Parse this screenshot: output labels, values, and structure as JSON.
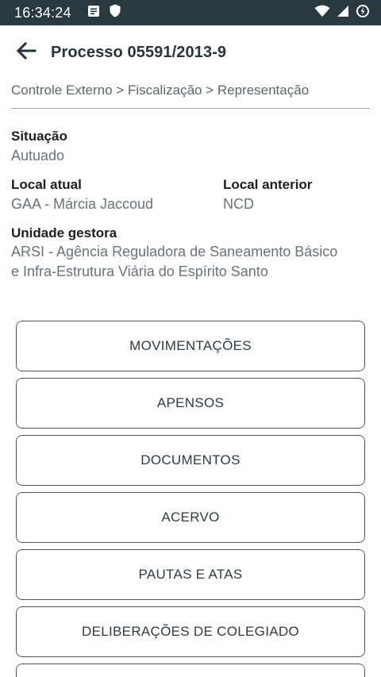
{
  "status_bar": {
    "time": "16:34:24",
    "icons": [
      "notes-icon",
      "shield-icon",
      "wifi-icon",
      "signal-icon",
      "battery-saver-icon"
    ]
  },
  "app_bar": {
    "title": "Processo 05591/2013-9",
    "back_icon": "arrow-left-icon"
  },
  "breadcrumb": "Controle Externo > Fiscalização > Representação",
  "details": {
    "situacao": {
      "label": "Situação",
      "value": "Autuado"
    },
    "local_atual": {
      "label": "Local atual",
      "value": "GAA - Márcia Jaccoud"
    },
    "local_anterior": {
      "label": "Local anterior",
      "value": "NCD"
    },
    "unidade_gestora": {
      "label": "Unidade gestora",
      "value_line1": "ARSI - Agência Reguladora de Saneamento Básico",
      "value_line2": "e Infra-Estrutura Viária do Espírito Santo"
    }
  },
  "actions": [
    {
      "label": "MOVIMENTAÇÕES"
    },
    {
      "label": "APENSOS"
    },
    {
      "label": "DOCUMENTOS"
    },
    {
      "label": "ACERVO"
    },
    {
      "label": "PAUTAS E ATAS"
    },
    {
      "label": "DELIBERAÇÕES DE COLEGIADO"
    },
    {
      "label": ""
    }
  ],
  "colors": {
    "status_bar": "#2a3840",
    "title_text": "#26343c",
    "button_border": "#4b5a62",
    "secondary_text": "#6a7378"
  }
}
